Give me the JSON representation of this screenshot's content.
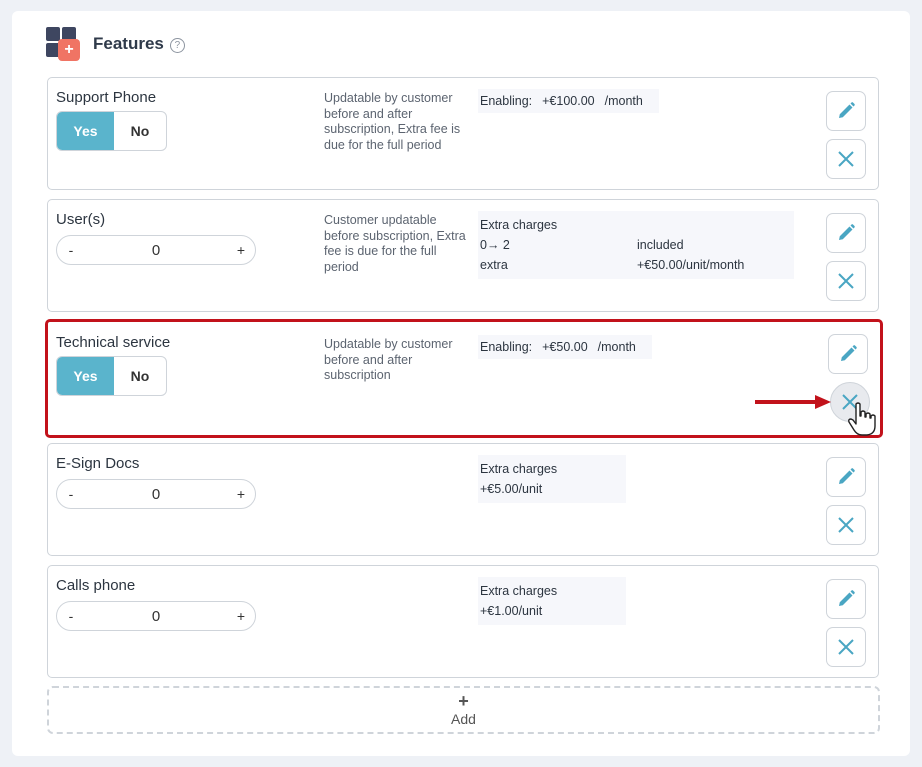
{
  "header": {
    "title": "Features",
    "help_icon": "question-circle-icon"
  },
  "colors": {
    "accent": "#5ab4cc",
    "highlight": "#c2121b",
    "logo_dark": "#3e4660",
    "logo_accent": "#f07464"
  },
  "features": [
    {
      "name": "Support Phone",
      "control": "toggle",
      "yes_label": "Yes",
      "no_label": "No",
      "selected": "Yes",
      "description": "Updatable by customer before and after subscription, Extra fee is due for the full period",
      "price_type": "enabling",
      "enabling_label": "Enabling:",
      "price": "+€100.00",
      "period": "/month"
    },
    {
      "name": "User(s)",
      "control": "stepper",
      "minus_label": "-",
      "value": "0",
      "plus_label": "+",
      "description": "Customer updatable before subscription, Extra fee is due for the full period",
      "price_type": "extra",
      "extra_title": "Extra charges",
      "rows": [
        {
          "c1": "0→ 2",
          "c2": "included"
        },
        {
          "c1": "extra",
          "c2": "+€50.00/unit/month"
        }
      ]
    },
    {
      "name": "Technical service",
      "control": "toggle",
      "yes_label": "Yes",
      "no_label": "No",
      "selected": "Yes",
      "description": "Updatable by customer before and after subscription",
      "price_type": "enabling",
      "enabling_label": "Enabling:",
      "price": "+€50.00",
      "period": "/month",
      "highlighted": true
    },
    {
      "name": "E-Sign Docs",
      "control": "stepper",
      "minus_label": "-",
      "value": "0",
      "plus_label": "+",
      "description": "",
      "price_type": "extra",
      "extra_title": "Extra charges",
      "single": "+€5.00/unit"
    },
    {
      "name": "Calls phone",
      "control": "stepper",
      "minus_label": "-",
      "value": "0",
      "plus_label": "+",
      "description": "",
      "price_type": "extra",
      "extra_title": "Extra charges",
      "single": "+€1.00/unit"
    }
  ],
  "add": {
    "plus": "+",
    "label": "Add"
  },
  "icons": {
    "edit": "pencil-icon",
    "delete": "close-icon",
    "arrow": "arrow-right-icon",
    "cursor": "hand-cursor-icon"
  }
}
